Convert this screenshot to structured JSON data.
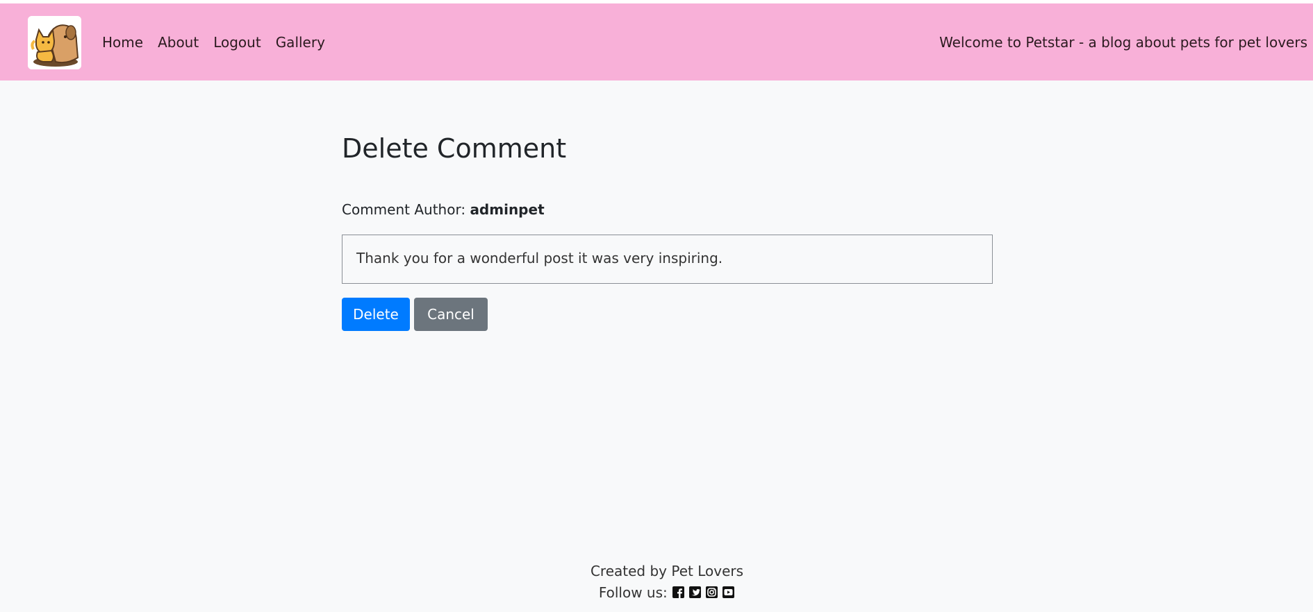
{
  "nav": {
    "logo_alt": "Petstar logo",
    "links": [
      {
        "label": "Home"
      },
      {
        "label": "About"
      },
      {
        "label": "Logout"
      },
      {
        "label": "Gallery"
      }
    ],
    "welcome": "Welcome to Petstar - a blog about pets for pet lovers"
  },
  "main": {
    "title": "Delete Comment",
    "author_label": "Comment Author: ",
    "author_name": "adminpet",
    "comment_text": "Thank you for a wonderful post it was very inspiring.",
    "delete_label": "Delete",
    "cancel_label": "Cancel"
  },
  "footer": {
    "created_by": "Created by Pet Lovers",
    "follow_label": "Follow us: ",
    "social": [
      "facebook-icon",
      "twitter-icon",
      "instagram-icon",
      "youtube-icon"
    ]
  },
  "colors": {
    "navbar": "#f8b0d8",
    "page_bg": "#f8f9fa",
    "delete_button": "#007bff",
    "cancel_button": "#6c757d"
  }
}
